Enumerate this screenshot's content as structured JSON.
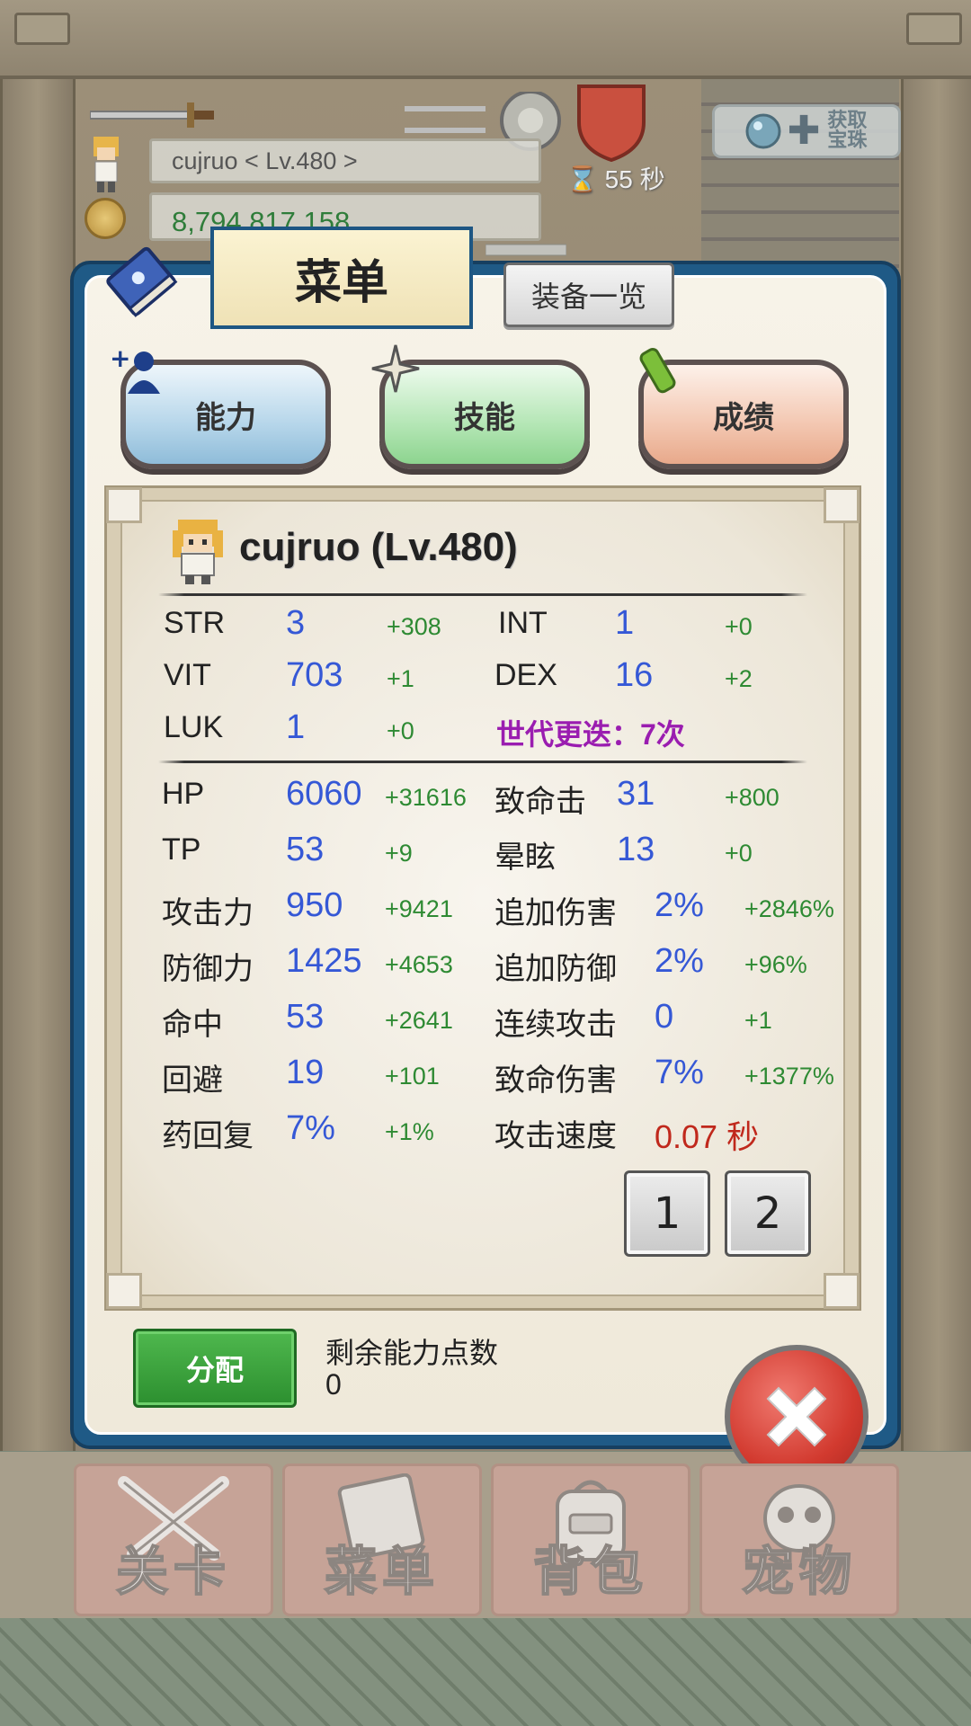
{
  "hud": {
    "name_level": "cujruo    < Lv.480 >",
    "gold": "8,794,817,158",
    "timer": "55 秒",
    "get_button_label": "获取宝珠"
  },
  "menu": {
    "title": "菜单",
    "equipment_list_label": "装备一览",
    "categories": [
      {
        "label": "能力"
      },
      {
        "label": "技能"
      },
      {
        "label": "成绩"
      }
    ]
  },
  "character": {
    "header": "cujruo (Lv.480)"
  },
  "base_stats": [
    {
      "label": "STR",
      "value": "3",
      "bonus": "+308"
    },
    {
      "label": "INT",
      "value": "1",
      "bonus": "+0"
    },
    {
      "label": "VIT",
      "value": "703",
      "bonus": "+1"
    },
    {
      "label": "DEX",
      "value": "16",
      "bonus": "+2"
    },
    {
      "label": "LUK",
      "value": "1",
      "bonus": "+0"
    }
  ],
  "generation": "世代更迭：7次",
  "combat_stats": [
    {
      "label": "HP",
      "value": "6060",
      "bonus": "+31616"
    },
    {
      "label": "致命击",
      "value": "31",
      "bonus": "+800"
    },
    {
      "label": "TP",
      "value": "53",
      "bonus": "+9"
    },
    {
      "label": "晕眩",
      "value": "13",
      "bonus": "+0"
    },
    {
      "label": "攻击力",
      "value": "950",
      "bonus": "+9421"
    },
    {
      "label": "追加伤害",
      "value": "2%",
      "bonus": "+2846%"
    },
    {
      "label": "防御力",
      "value": "1425",
      "bonus": "+4653"
    },
    {
      "label": "追加防御",
      "value": "2%",
      "bonus": "+96%"
    },
    {
      "label": "命中",
      "value": "53",
      "bonus": "+2641"
    },
    {
      "label": "连续攻击",
      "value": "0",
      "bonus": "+1"
    },
    {
      "label": "回避",
      "value": "19",
      "bonus": "+101"
    },
    {
      "label": "致命伤害",
      "value": "7%",
      "bonus": "+1377%"
    },
    {
      "label": "药回复",
      "value": "7%",
      "bonus": "+1%"
    },
    {
      "label": "攻击速度",
      "value": "0.07 秒"
    }
  ],
  "pages": [
    "1",
    "2"
  ],
  "assign_label": "分配",
  "remaining_points_label": "剩余能力点数",
  "remaining_points_value": "0",
  "bottom_nav": [
    {
      "label": "关卡"
    },
    {
      "label": "菜单"
    },
    {
      "label": "背包"
    },
    {
      "label": "宠物"
    }
  ],
  "colors": {
    "panel_border": "#1f5a86",
    "stat_value": "#3558d6",
    "stat_bonus": "#2e8a33",
    "generation": "#9a1db0",
    "attack_speed": "#c0281c",
    "assign_button": "#2c8f2f",
    "close_button": "#d23a2f"
  }
}
